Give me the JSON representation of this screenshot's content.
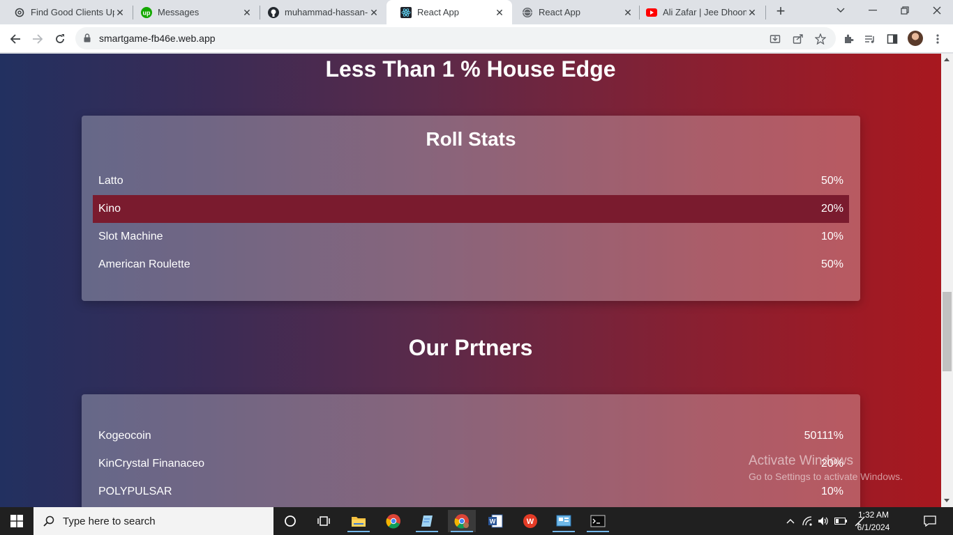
{
  "browser": {
    "tabs": [
      {
        "title": "Find Good Clients Upw",
        "icon": "openai-icon",
        "active": false
      },
      {
        "title": "Messages",
        "icon": "upwork-icon",
        "active": false
      },
      {
        "title": "muhammad-hassan-m",
        "icon": "github-icon",
        "active": false
      },
      {
        "title": "React App",
        "icon": "react-icon",
        "active": true
      },
      {
        "title": "React App",
        "icon": "globe-icon",
        "active": false
      },
      {
        "title": "Ali Zafar | Jee Dhoond",
        "icon": "youtube-icon",
        "active": false
      }
    ],
    "url": "smartgame-fb46e.web.app"
  },
  "page": {
    "house_edge_heading": "Less Than 1 % House Edge",
    "roll_stats": {
      "title": "Roll Stats",
      "rows": [
        {
          "name": "Latto",
          "value": "50%",
          "highlighted": false
        },
        {
          "name": "Kino",
          "value": "20%",
          "highlighted": true
        },
        {
          "name": "Slot Machine",
          "value": "10%",
          "highlighted": false
        },
        {
          "name": "American Roulette",
          "value": "50%",
          "highlighted": false
        }
      ]
    },
    "partners_heading": "Our Prtners",
    "partners": {
      "rows": [
        {
          "name": "Kogeocoin",
          "value": "50111%"
        },
        {
          "name": "KinCrystal Finanaceo",
          "value": "20%"
        },
        {
          "name": "POLYPULSAR",
          "value": "10%"
        }
      ]
    }
  },
  "watermark": {
    "line1": "Activate Windows",
    "line2": "Go to Settings to activate Windows."
  },
  "taskbar": {
    "search_placeholder": "Type here to search",
    "time": "1:32 AM",
    "date": "6/1/2024"
  },
  "colors": {
    "gradient_left": "#223060",
    "gradient_right": "#a8181f",
    "highlight_row": "#7a1b2e"
  }
}
